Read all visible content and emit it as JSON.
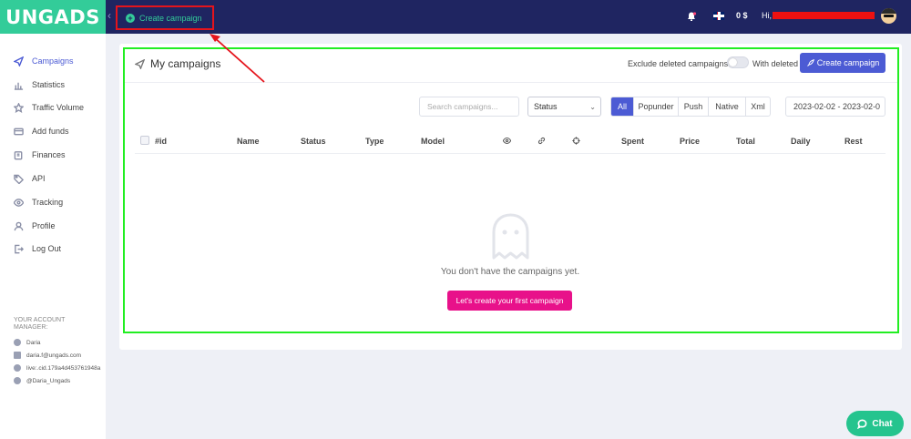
{
  "brand": {
    "logo": "UNGADS",
    "accent": "#33cc99",
    "topbar_color": "#1f2561",
    "primary": "#4c5bd4",
    "pink": "#e8118a"
  },
  "topbar": {
    "create_label": "Create campaign",
    "balance": "0 $",
    "greeting": "Hi,"
  },
  "sidebar": {
    "items": [
      {
        "label": "Campaigns",
        "icon": "send-icon"
      },
      {
        "label": "Statistics",
        "icon": "bar-chart-icon"
      },
      {
        "label": "Traffic Volume",
        "icon": "star-icon"
      },
      {
        "label": "Add funds",
        "icon": "credit-card-icon"
      },
      {
        "label": "Finances",
        "icon": "wallet-icon"
      },
      {
        "label": "API",
        "icon": "tag-icon"
      },
      {
        "label": "Tracking",
        "icon": "eye-icon"
      },
      {
        "label": "Profile",
        "icon": "user-icon"
      },
      {
        "label": "Log Out",
        "icon": "logout-icon"
      }
    ],
    "manager_title": "YOUR ACCOUNT MANAGER:",
    "manager": {
      "name": "Daria",
      "email": "daria.f@ungads.com",
      "skype": "live:.cid.179a4d453761948a",
      "telegram": "@Daria_Ungads"
    }
  },
  "main": {
    "title": "My campaigns",
    "exclude_label": "Exclude deleted campaigns",
    "with_deleted_label": "With deleted",
    "create_button": "Create campaign",
    "search_placeholder": "Search campaigns...",
    "status_select": "Status",
    "filters": [
      "All",
      "Popunder",
      "Push",
      "Native",
      "Xml"
    ],
    "date_range": "2023-02-02 - 2023-02-0",
    "columns": [
      "#id",
      "Name",
      "Status",
      "Type",
      "Model",
      "Spent",
      "Price",
      "Total",
      "Daily",
      "Rest"
    ],
    "empty_text": "You don't have the campaigns yet.",
    "empty_button": "Let's create your first campaign"
  },
  "chat": {
    "label": "Chat"
  }
}
